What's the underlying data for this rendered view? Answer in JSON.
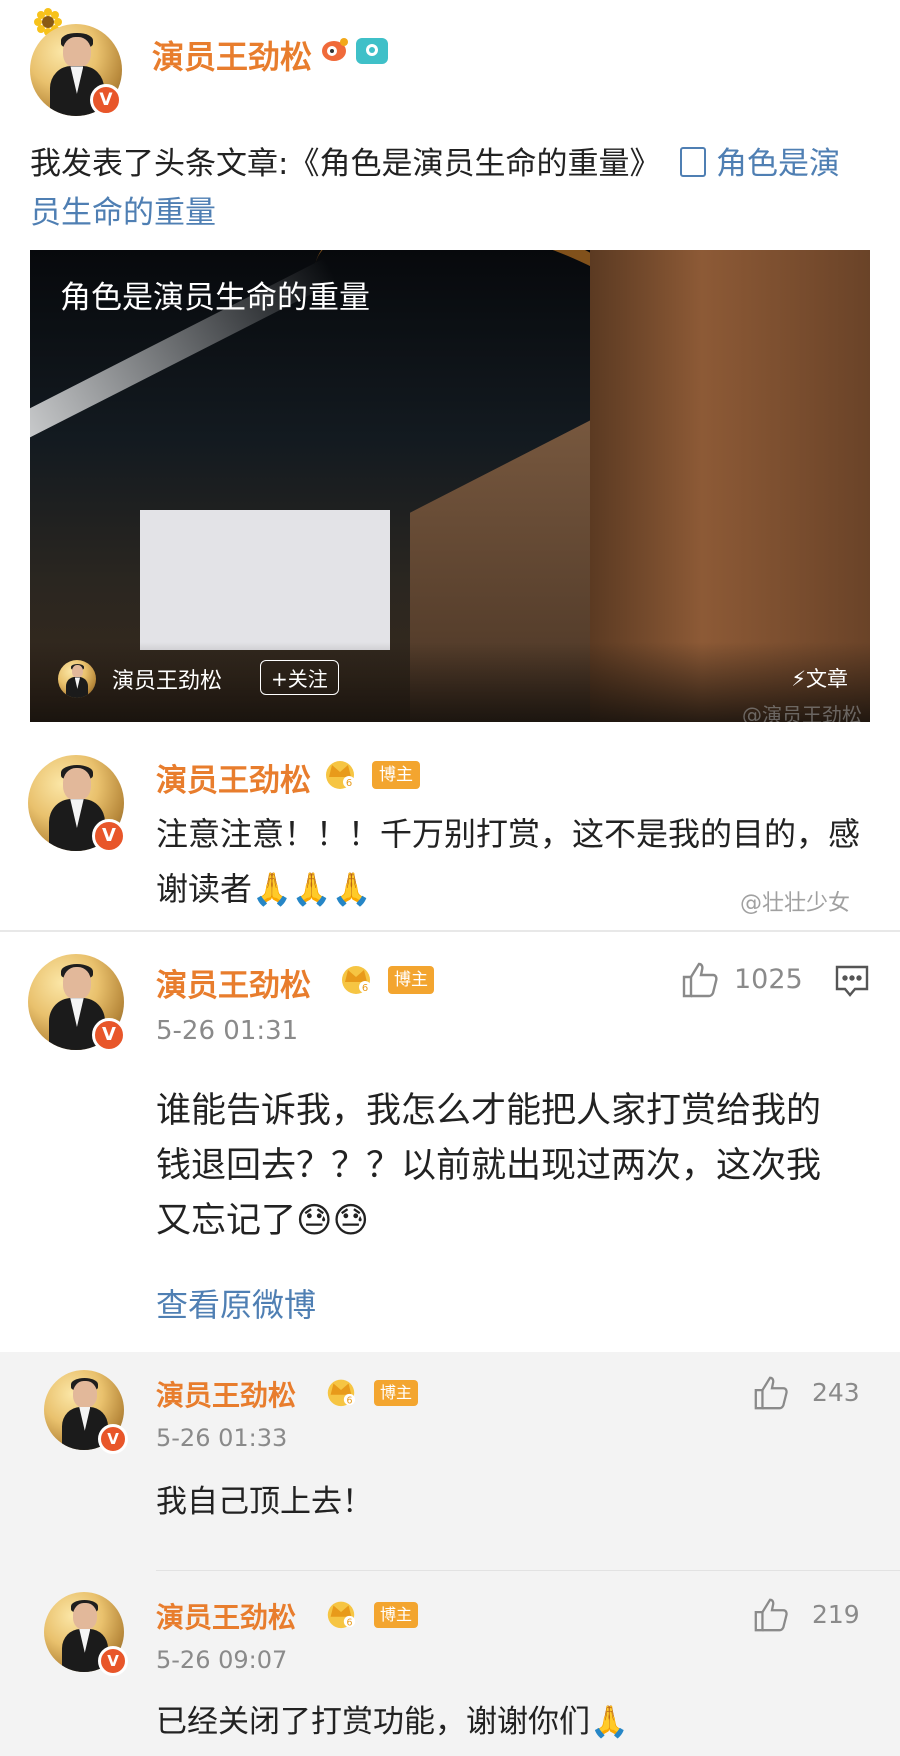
{
  "post": {
    "author": "演员王劲松",
    "text_prefix": "我发表了头条文章:《角色是演员生命的重量》",
    "link_text": "角色是演员生命的重量",
    "image_title": "角色是演员生命的重量",
    "overlay_author": "演员王劲松",
    "follow_label": "+关注",
    "article_label": "⚡文章",
    "image_watermark": "@演员王劲松"
  },
  "comment1": {
    "author": "演员王劲松",
    "tag": "博主",
    "text": "注意注意！！！千万别打赏，这不是我的目的，感谢读者🙏🙏🙏",
    "watermark": "@壮壮少女"
  },
  "comment2": {
    "author": "演员王劲松",
    "tag": "博主",
    "time": "5-26 01:31",
    "likes": "1025",
    "text": "谁能告诉我，我怎么才能把人家打赏给我的钱退回去？？？以前就出现过两次，这次我又忘记了😓😓",
    "view_original": "查看原微博"
  },
  "replies": [
    {
      "author": "演员王劲松",
      "tag": "博主",
      "time": "5-26 01:33",
      "likes": "243",
      "text": "我自己顶上去！"
    },
    {
      "author": "演员王劲松",
      "tag": "博主",
      "time": "5-26 09:07",
      "likes": "219",
      "text": "已经关闭了打赏功能，谢谢你们🙏"
    }
  ],
  "colors": {
    "name": "#e87d2d",
    "link": "#4f7fb3",
    "tag": "#f3a52f",
    "badge": "#e8562a"
  },
  "icons": [
    "sunflower-icon",
    "weibo-level-icon",
    "camera-icon",
    "vip-crown-icon",
    "verified-v-icon",
    "thumbs-up-icon",
    "comment-icon",
    "article-icon"
  ]
}
